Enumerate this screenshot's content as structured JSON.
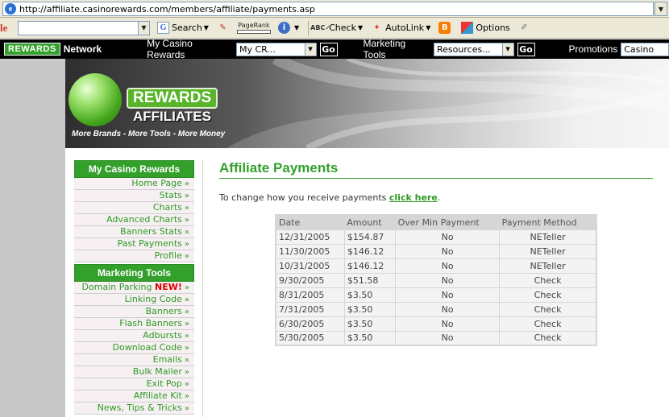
{
  "browser": {
    "url": "http://affiliate.casinorewards.com/members/affiliate/payments.asp"
  },
  "toolbar": {
    "logo_fragment": "le",
    "search_label": "Search",
    "pagerank_label": "PageRank",
    "check_label": "Check",
    "autolink_label": "AutoLink",
    "options_label": "Options"
  },
  "network": {
    "logo": "REWARDS",
    "network_word": "Network",
    "my_casino_label": "My Casino Rewards",
    "my_casino_select": "My CR...",
    "go1": "Go",
    "marketing_label": "Marketing Tools",
    "marketing_select": "Resources...",
    "go2": "Go",
    "promotions_label": "Promotions",
    "promotions_select": "Casino"
  },
  "banner": {
    "rewards": "REWARDS",
    "affiliates": "AFFILIATES",
    "tagline": "More Brands - More Tools - More Money"
  },
  "nav": {
    "section1_title": "My Casino Rewards",
    "section1_items": [
      "Home Page",
      "Stats",
      "Charts",
      "Advanced Charts",
      "Banners Stats",
      "Past Payments",
      "Profile"
    ],
    "section2_title": "Marketing Tools",
    "domain_parking": "Domain Parking",
    "new_badge": "NEW!",
    "section2_items": [
      "Linking Code",
      "Banners",
      "Flash Banners",
      "Adbursts",
      "Download Code",
      "Emails",
      "Bulk Mailer",
      "Exit Pop",
      "Affiliate Kit",
      "News, Tips & Tricks"
    ]
  },
  "main": {
    "title": "Affiliate Payments",
    "intro_text": "To change how you receive payments",
    "intro_link": "click here",
    "intro_end": "."
  },
  "payments": {
    "headers": [
      "Date",
      "Amount",
      "Over Min Payment",
      "Payment Method"
    ],
    "rows": [
      [
        "12/31/2005",
        "$154.87",
        "No",
        "NETeller"
      ],
      [
        "11/30/2005",
        "$146.12",
        "No",
        "NETeller"
      ],
      [
        "10/31/2005",
        "$146.12",
        "No",
        "NETeller"
      ],
      [
        "9/30/2005",
        "$51.58",
        "No",
        "Check"
      ],
      [
        "8/31/2005",
        "$3.50",
        "No",
        "Check"
      ],
      [
        "7/31/2005",
        "$3.50",
        "No",
        "Check"
      ],
      [
        "6/30/2005",
        "$3.50",
        "No",
        "Check"
      ],
      [
        "5/30/2005",
        "$3.50",
        "No",
        "Check"
      ]
    ]
  }
}
